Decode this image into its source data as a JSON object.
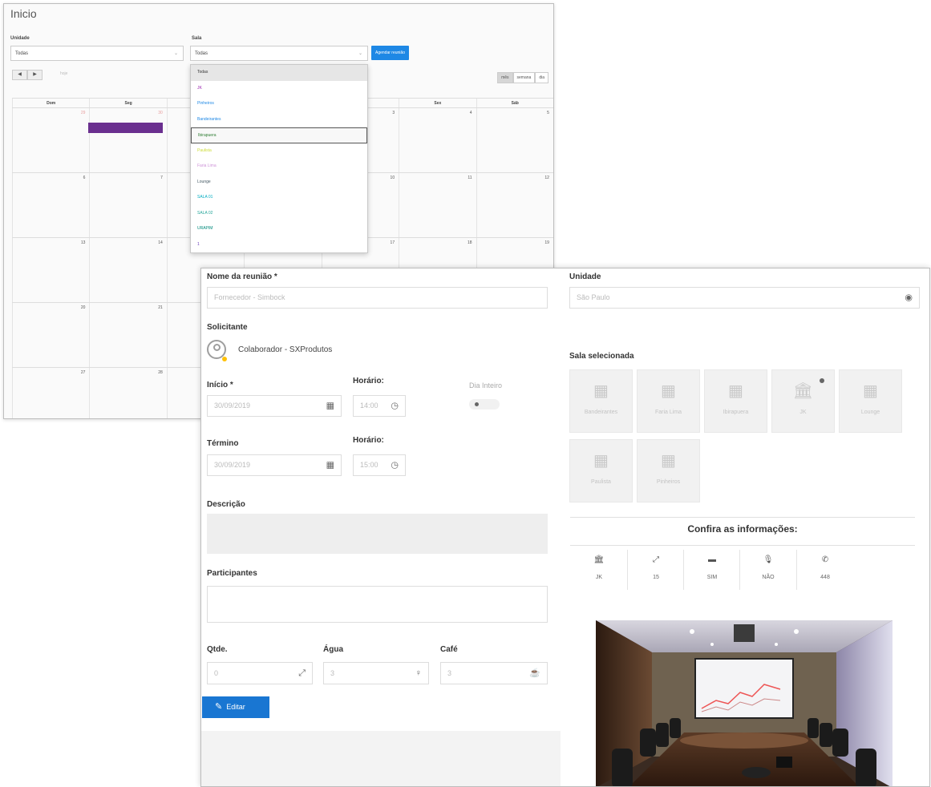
{
  "calendar": {
    "title": "Inicio",
    "unidade_label": "Unidade",
    "unidade_value": "Todas",
    "sala_label": "Sala",
    "sala_value": "Todas",
    "schedule_button": "Agendar reunião",
    "nav_prev": "◀",
    "nav_next": "▶",
    "today_label": "hoje",
    "views": [
      "mês",
      "semana",
      "dia"
    ],
    "weekdays": [
      "Dom",
      "Seg",
      "",
      "",
      "",
      "Sex",
      "Sáb"
    ],
    "rows": [
      [
        "29",
        "30",
        "",
        "",
        "3",
        "4",
        "5"
      ],
      [
        "6",
        "7",
        "",
        "",
        "10",
        "11",
        "12"
      ],
      [
        "13",
        "14",
        "",
        "",
        "17",
        "18",
        "19"
      ],
      [
        "20",
        "21",
        "",
        "",
        "",
        "",
        ""
      ],
      [
        "27",
        "28",
        "",
        "",
        "",
        "",
        ""
      ]
    ],
    "event_color": "#6a2f8f",
    "sala_options": [
      {
        "label": "Todas",
        "color": "#333333"
      },
      {
        "label": "JK",
        "color": "#9c27b0"
      },
      {
        "label": "Pinheiros",
        "color": "#1e88e5"
      },
      {
        "label": "Bandeirantes",
        "color": "#1e88e5"
      },
      {
        "label": "Ibirapuera",
        "color": "#2e7d32"
      },
      {
        "label": "Paulista",
        "color": "#cddc39"
      },
      {
        "label": "Faria Lima",
        "color": "#ce93d8"
      },
      {
        "label": "Lounge",
        "color": "#455a64"
      },
      {
        "label": "SALA 01",
        "color": "#00acc1"
      },
      {
        "label": "SALA 02",
        "color": "#26a69a"
      },
      {
        "label": "URAPIM",
        "color": "#00897b"
      },
      {
        "label": "1",
        "color": "#673ab7"
      }
    ]
  },
  "form": {
    "nome_label": "Nome da reunião *",
    "nome_value": "Fornecedor - Simbock",
    "unidade_label": "Unidade",
    "unidade_value": "São Paulo",
    "solicitante_label": "Solicitante",
    "solicitante_name": "Colaborador - SXProdutos",
    "inicio_label": "Início *",
    "inicio_date": "30/09/2019",
    "horario1_label": "Horário:",
    "horario1_value": "14:00",
    "dia_inteiro_label": "Dia Inteiro",
    "termino_label": "Término",
    "termino_date": "30/09/2019",
    "horario2_label": "Horário:",
    "horario2_value": "15:00",
    "descricao_label": "Descrição",
    "participantes_label": "Participantes",
    "qtde_label": "Qtde.",
    "qtde_value": "0",
    "agua_label": "Água",
    "agua_value": "3",
    "cafe_label": "Café",
    "cafe_value": "3",
    "edit_button": "Editar",
    "sala_sel_label": "Sala selecionada",
    "rooms": [
      {
        "name": "Bandeirantes",
        "icon": "calendar-icon"
      },
      {
        "name": "Faria Lima",
        "icon": "calendar-icon"
      },
      {
        "name": "Ibirapuera",
        "icon": "calendar-icon"
      },
      {
        "name": "JK",
        "icon": "institution-icon"
      },
      {
        "name": "Lounge",
        "icon": "calendar-icon"
      },
      {
        "name": "Paulista",
        "icon": "calendar-icon"
      },
      {
        "name": "Pinheiros",
        "icon": "calendar-icon"
      }
    ],
    "confira_title": "Confira as informações:",
    "info": [
      {
        "icon": "institution-icon",
        "value": "JK"
      },
      {
        "icon": "resize-icon",
        "value": "15"
      },
      {
        "icon": "tv-icon",
        "value": "SIM"
      },
      {
        "icon": "microphone-icon",
        "value": "NÃO"
      },
      {
        "icon": "phone-icon",
        "value": "448"
      }
    ]
  }
}
